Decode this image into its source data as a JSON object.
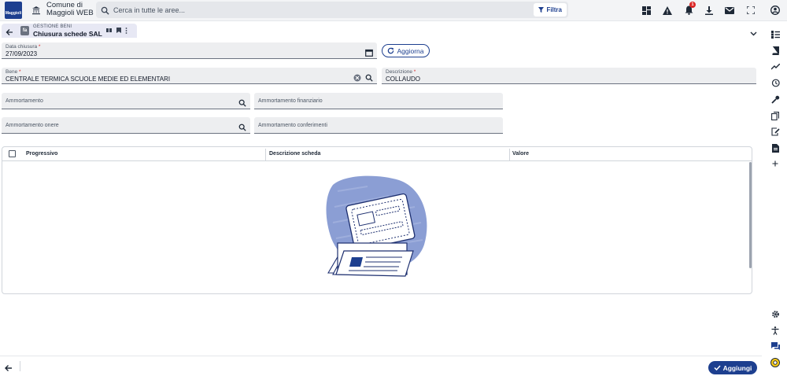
{
  "header": {
    "logo_text": "Maggioli",
    "org_name_line1": "Comune di",
    "org_name_line2": "Maggioli WEB",
    "search_placeholder": "Cerca in tutte le aree...",
    "filter_label": "Filtra",
    "notification_count": "1"
  },
  "tab": {
    "module_badge": "fa",
    "kicker": "GESTIONE BENI",
    "title": "Chiusura schede SAL"
  },
  "form": {
    "data_chiusura": {
      "label": "Data chiusura",
      "value": "27/09/2023"
    },
    "aggiorna_label": "Aggiorna",
    "bene": {
      "label": "Bene",
      "value": "CENTRALE TERMICA SCUOLE MEDIE ED ELEMENTARI"
    },
    "descrizione": {
      "label": "Descrizione",
      "value": "COLLAUDO"
    },
    "ammortamento": {
      "placeholder": "Ammortamento"
    },
    "ammortamento_finanziario": {
      "placeholder": "Ammortamento finanziario"
    },
    "ammortamento_onere": {
      "placeholder": "Ammortamento onere"
    },
    "ammortamento_conferimenti": {
      "placeholder": "Ammortamento conferimenti"
    }
  },
  "grid": {
    "columns": [
      "Progressivo",
      "Descrizione scheda",
      "Valore"
    ]
  },
  "footer": {
    "add_label": "Aggiungi"
  },
  "colors": {
    "primary": "#1d3f8f",
    "required": "#dc2626",
    "field_bg": "#edeef0",
    "tab_bg": "#e7e8f4"
  }
}
